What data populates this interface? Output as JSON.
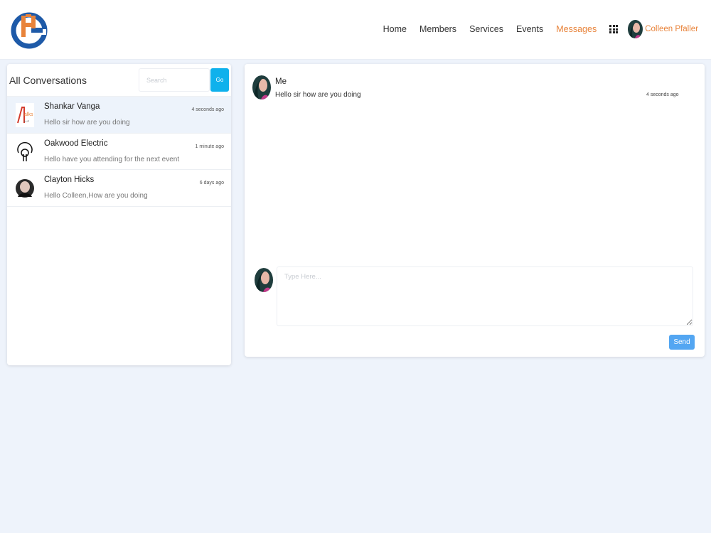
{
  "header": {
    "nav": [
      {
        "label": "Home",
        "active": false
      },
      {
        "label": "Members",
        "active": false
      },
      {
        "label": "Services",
        "active": false
      },
      {
        "label": "Events",
        "active": false
      },
      {
        "label": "Messages",
        "active": true
      }
    ],
    "apps_icon": "grid-icon",
    "user_name": "Colleen Pfaller"
  },
  "conversations": {
    "title": "All Conversations",
    "search_placeholder": "Search",
    "go_label": "Go",
    "items": [
      {
        "name": "Shankar Vanga",
        "time": "4 seconds ago",
        "preview": "Hello sir how are you doing",
        "selected": true
      },
      {
        "name": "Oakwood Electric",
        "time": "1 minute ago",
        "preview": "Hello have you attending for the next event",
        "selected": false
      },
      {
        "name": "Clayton Hicks",
        "time": "6 days ago",
        "preview": "Hello Colleen,How are you doing",
        "selected": false
      }
    ]
  },
  "chat": {
    "messages": [
      {
        "sender": "Me",
        "text": "Hello sir how are you doing",
        "time": "4 seconds ago"
      }
    ],
    "compose_placeholder": "Type Here...",
    "send_label": "Send"
  },
  "colors": {
    "accent_orange": "#e8833a",
    "go_button": "#0fb1ec",
    "send_button": "#53a6f2",
    "page_background": "#eef3fb",
    "logo_blue": "#1e5aa8"
  }
}
